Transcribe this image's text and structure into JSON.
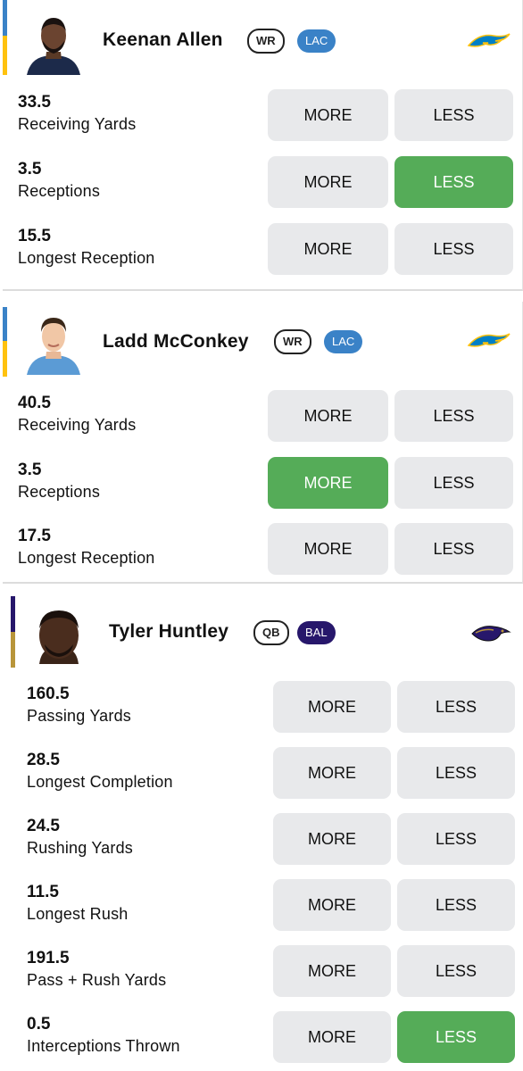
{
  "colors": {
    "selected": "#55ac58",
    "button": "#e8e9eb",
    "lac": "#3a82c7",
    "bal": "#27176b",
    "bolt": "#0080c6",
    "bolt_gold": "#ffc20e"
  },
  "players": [
    {
      "name": "Keenan Allen",
      "position": "WR",
      "team": "LAC",
      "logo_icon": "chargers-logo-icon",
      "props": [
        {
          "value": "33.5",
          "stat": "Receiving Yards",
          "more": "MORE",
          "less": "LESS",
          "selected": "none"
        },
        {
          "value": "3.5",
          "stat": "Receptions",
          "more": "MORE",
          "less": "LESS",
          "selected": "less"
        },
        {
          "value": "15.5",
          "stat": "Longest Reception",
          "more": "MORE",
          "less": "LESS",
          "selected": "none"
        }
      ]
    },
    {
      "name": "Ladd McConkey",
      "position": "WR",
      "team": "LAC",
      "logo_icon": "chargers-logo-icon",
      "props": [
        {
          "value": "40.5",
          "stat": "Receiving Yards",
          "more": "MORE",
          "less": "LESS",
          "selected": "none"
        },
        {
          "value": "3.5",
          "stat": "Receptions",
          "more": "MORE",
          "less": "LESS",
          "selected": "more"
        },
        {
          "value": "17.5",
          "stat": "Longest Reception",
          "more": "MORE",
          "less": "LESS",
          "selected": "none"
        }
      ]
    },
    {
      "name": "Tyler Huntley",
      "position": "QB",
      "team": "BAL",
      "logo_icon": "ravens-logo-icon",
      "props": [
        {
          "value": "160.5",
          "stat": "Passing Yards",
          "more": "MORE",
          "less": "LESS",
          "selected": "none"
        },
        {
          "value": "28.5",
          "stat": "Longest Completion",
          "more": "MORE",
          "less": "LESS",
          "selected": "none"
        },
        {
          "value": "24.5",
          "stat": "Rushing Yards",
          "more": "MORE",
          "less": "LESS",
          "selected": "none"
        },
        {
          "value": "11.5",
          "stat": "Longest Rush",
          "more": "MORE",
          "less": "LESS",
          "selected": "none"
        },
        {
          "value": "191.5",
          "stat": "Pass + Rush Yards",
          "more": "MORE",
          "less": "LESS",
          "selected": "none"
        },
        {
          "value": "0.5",
          "stat": "Interceptions Thrown",
          "more": "MORE",
          "less": "LESS",
          "selected": "less"
        }
      ]
    }
  ]
}
